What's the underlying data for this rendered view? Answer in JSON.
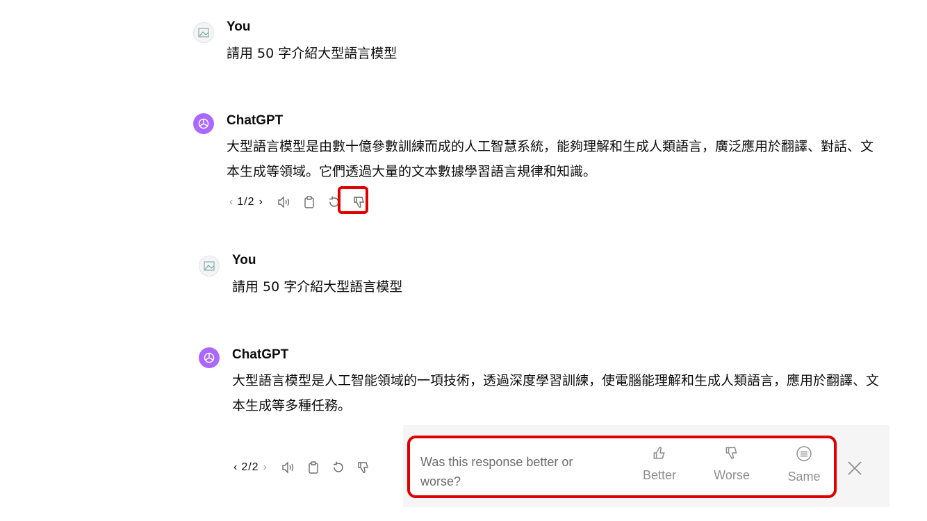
{
  "conversation": [
    {
      "role": "user",
      "name": "You",
      "text": "請用 50 字介紹大型語言模型"
    },
    {
      "role": "assistant",
      "name": "ChatGPT",
      "text": "大型語言模型是由數十億參數訓練而成的人工智慧系統，能夠理解和生成人類語言，廣泛應用於翻譯、對話、文本生成等領域。它們透過大量的文本數據學習語言規律和知識。",
      "pager": "1/2"
    },
    {
      "role": "user",
      "name": "You",
      "text": "請用 50 字介紹大型語言模型"
    },
    {
      "role": "assistant",
      "name": "ChatGPT",
      "text": "大型語言模型是人工智能領域的一項技術，透過深度學習訓練，使電腦能理解和生成人類語言，應用於翻譯、文本生成等多種任務。",
      "pager": "2/2"
    }
  ],
  "feedback": {
    "question": "Was this response better or worse?",
    "options": [
      {
        "label": "Better",
        "icon": "thumbs-up-icon"
      },
      {
        "label": "Worse",
        "icon": "thumbs-down-icon"
      },
      {
        "label": "Same",
        "icon": "equal-circle-icon"
      }
    ],
    "close_icon": "close-icon"
  },
  "colors": {
    "highlight": "#e00000",
    "gpt_avatar": "#ab68ff"
  }
}
